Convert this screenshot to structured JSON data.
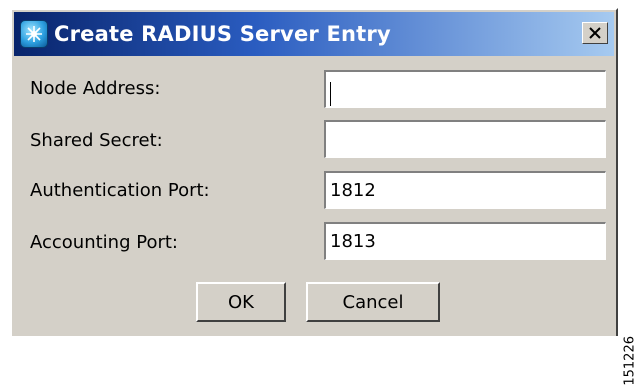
{
  "dialog": {
    "title": "Create RADIUS Server Entry",
    "icon": "radius-server-icon",
    "close_icon": "close-icon"
  },
  "form": {
    "fields": [
      {
        "label": "Node Address:",
        "value": ""
      },
      {
        "label": "Shared Secret:",
        "value": ""
      },
      {
        "label": "Authentication Port:",
        "value": "1812"
      },
      {
        "label": "Accounting Port:",
        "value": "1813"
      }
    ]
  },
  "buttons": {
    "ok": "OK",
    "cancel": "Cancel"
  },
  "side_code": "151226",
  "colors": {
    "dialog_bg": "#d4d0c8",
    "titlebar_start": "#08246b",
    "titlebar_end": "#a6caf0",
    "title_text": "#ffffff"
  }
}
